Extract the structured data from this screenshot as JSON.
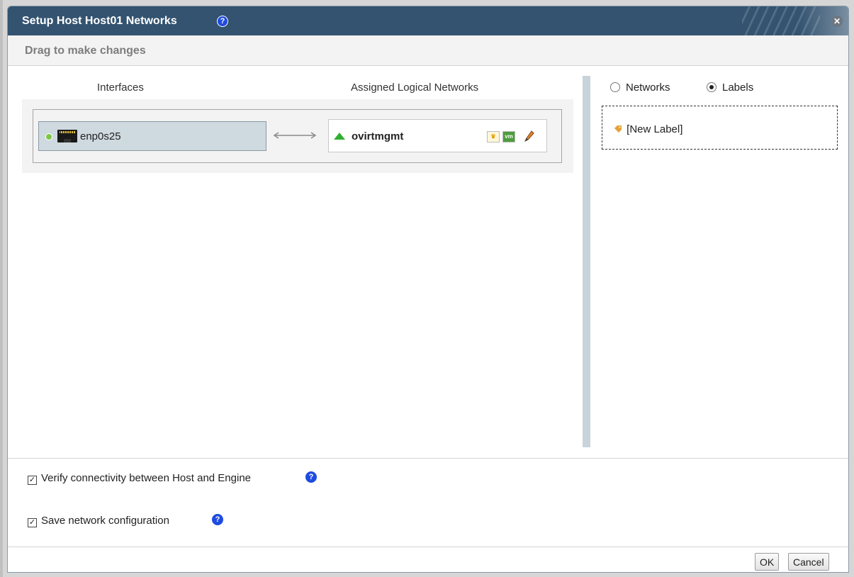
{
  "dialog": {
    "title": "Setup Host Host01 Networks",
    "subtitle": "Drag to make changes"
  },
  "columns": {
    "interfaces": "Interfaces",
    "assigned": "Assigned Logical Networks"
  },
  "interface": {
    "name": "enp0s25",
    "status": "up"
  },
  "network": {
    "name": "ovirtmgmt",
    "status": "up",
    "badges": [
      "mgmt-icon",
      "vm-icon"
    ],
    "vm_badge_text": "vm"
  },
  "view_toggle": {
    "options": [
      "Networks",
      "Labels"
    ],
    "selected": "Labels"
  },
  "labels": {
    "items": [
      "[New Label]"
    ]
  },
  "options": {
    "verify_connectivity": "Verify connectivity between Host and Engine",
    "verify_checked": true,
    "save_config": "Save network configuration",
    "save_checked": true
  },
  "buttons": {
    "ok": "OK",
    "cancel": "Cancel"
  },
  "colors": {
    "titlebar": "#335370",
    "nic_bg": "#cfd9e0",
    "status_green": "#7ac943",
    "help_blue": "#1f4be0"
  }
}
